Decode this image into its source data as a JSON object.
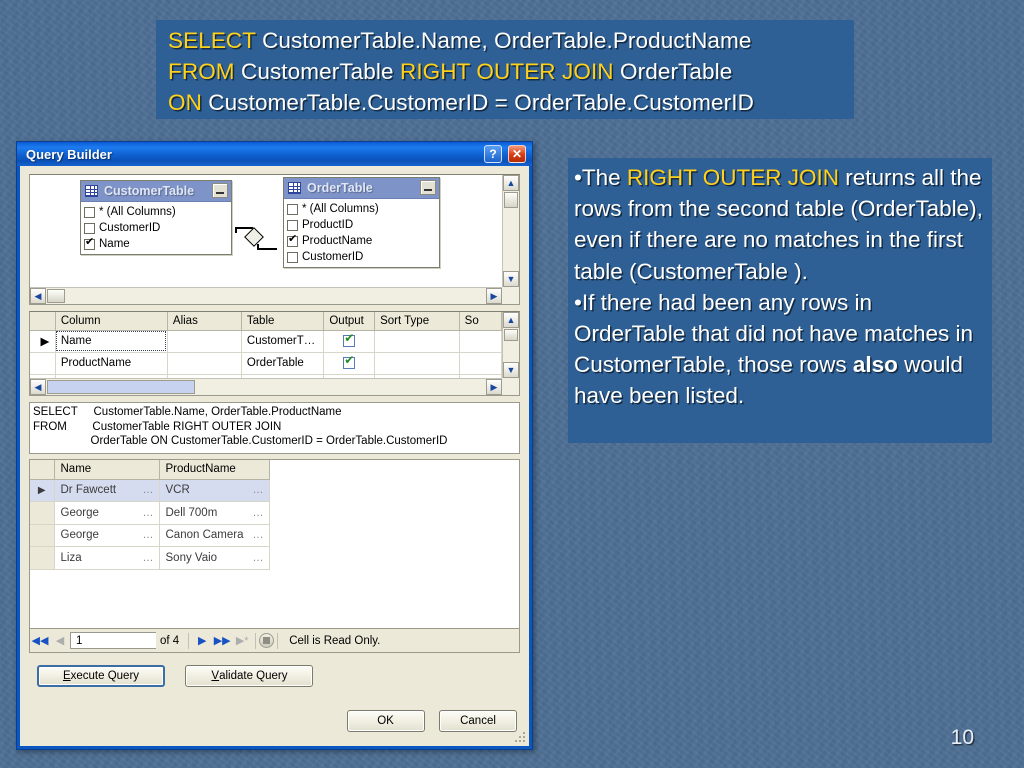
{
  "slide": {
    "page_number": "10",
    "sql_banner": {
      "lines": [
        {
          "keyword": "SELECT",
          "rest": " CustomerTable.Name, OrderTable.ProductName"
        },
        {
          "keyword": "FROM",
          "mid": " CustomerTable ",
          "keyword2": "RIGHT OUTER JOIN",
          "rest": " OrderTable"
        },
        {
          "keyword": "ON",
          "rest": " CustomerTable.CustomerID = OrderTable.CustomerID"
        }
      ]
    },
    "explanation": {
      "bullet1_pre": "•The ",
      "bullet1_kw": "RIGHT OUTER JOIN",
      "bullet1_post": " returns all the rows from the second table (OrderTable), even if there are no matches in the first table (CustomerTable ).",
      "bullet2_pre": "•If there had been any rows in OrderTable that did not have matches in CustomerTable, those rows ",
      "bullet2_bold": "also",
      "bullet2_post": " would have been listed."
    }
  },
  "dialog": {
    "title": "Query Builder",
    "help_button": "?",
    "close_button": "✕",
    "diagram": {
      "tables": [
        {
          "name": "CustomerTable",
          "columns": [
            {
              "label": "* (All Columns)",
              "checked": false
            },
            {
              "label": "CustomerID",
              "checked": false
            },
            {
              "label": "Name",
              "checked": true
            }
          ]
        },
        {
          "name": "OrderTable",
          "columns": [
            {
              "label": "* (All Columns)",
              "checked": false
            },
            {
              "label": "ProductID",
              "checked": false
            },
            {
              "label": "ProductName",
              "checked": true
            },
            {
              "label": "CustomerID",
              "checked": false
            }
          ]
        }
      ]
    },
    "column_grid": {
      "headers": [
        "Column",
        "Alias",
        "Table",
        "Output",
        "Sort Type",
        "So"
      ],
      "rows": [
        {
          "column": "Name",
          "alias": "",
          "table": "CustomerT…",
          "output": true,
          "sort_type": "",
          "sort_order": "",
          "current": true
        },
        {
          "column": "ProductName",
          "alias": "",
          "table": "OrderTable",
          "output": true,
          "sort_type": "",
          "sort_order": "",
          "current": false
        },
        {
          "column": "",
          "alias": "",
          "table": "",
          "output": true,
          "sort_type": "",
          "sort_order": "",
          "current": false
        }
      ]
    },
    "sql_text": "SELECT     CustomerTable.Name, OrderTable.ProductName\nFROM        CustomerTable RIGHT OUTER JOIN\n                  OrderTable ON CustomerTable.CustomerID = OrderTable.CustomerID",
    "results": {
      "headers": [
        "Name",
        "ProductName"
      ],
      "rows": [
        {
          "name": "Dr Fawcett",
          "product": "VCR"
        },
        {
          "name": "George",
          "product": "Dell 700m"
        },
        {
          "name": "George",
          "product": "Canon Camera"
        },
        {
          "name": "Liza",
          "product": "Sony Vaio"
        }
      ],
      "ellipsis": "…"
    },
    "navigator": {
      "first": "◀◀",
      "prev": "◀",
      "page_value": "1",
      "of_label": "of 4",
      "next": "▶",
      "last": "▶▶",
      "new": "▶*",
      "stop": "■",
      "status": "Cell is Read Only."
    },
    "buttons": {
      "execute_query": "Execute Query",
      "execute_query_accel": "E",
      "validate_query": "Validate Query",
      "validate_query_accel": "V",
      "ok": "OK",
      "cancel": "Cancel"
    }
  },
  "colors": {
    "accent_yellow": "#ffd11a",
    "banner_blue": "#2e6096",
    "background_blue": "#4e6f94",
    "titlebar_blue": "#1d7bef"
  }
}
